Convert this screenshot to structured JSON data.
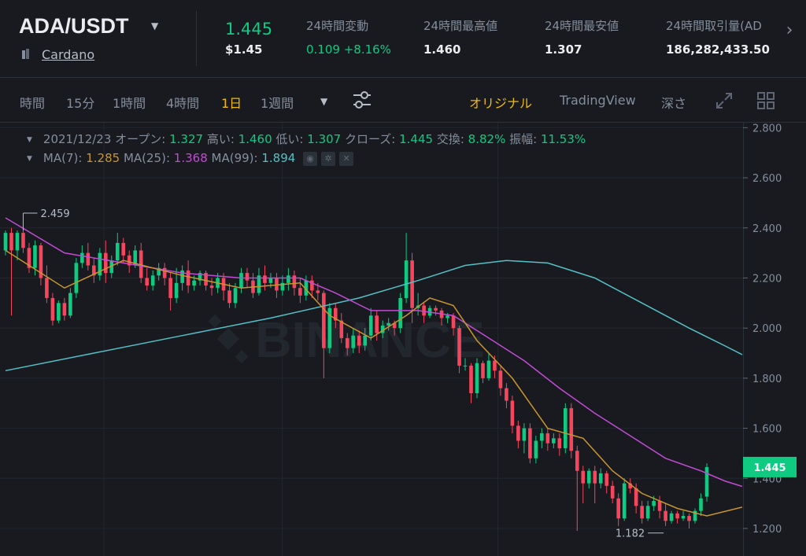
{
  "header": {
    "pair": "ADA/USDT",
    "coin_name": "Cardano",
    "last_price": "1.445",
    "last_price_usd": "$1.45",
    "stats": [
      {
        "label": "24時間変動",
        "value": "0.109 +8.16%",
        "green": true
      },
      {
        "label": "24時間最高値",
        "value": "1.460",
        "green": false
      },
      {
        "label": "24時間最安値",
        "value": "1.307",
        "green": false
      },
      {
        "label": "24時間取引量(AD",
        "value": "186,282,433.50",
        "green": false
      }
    ]
  },
  "toolbar": {
    "intervals": [
      "時間",
      "15分",
      "1時間",
      "4時間",
      "1日",
      "1週間"
    ],
    "active_interval": "1日",
    "views": [
      "オリジナル",
      "TradingView",
      "深さ"
    ],
    "active_view": "オリジナル"
  },
  "ohlc_bar": {
    "date": "2021/12/23",
    "open_label": "オープン:",
    "open": "1.327",
    "high_label": "高い:",
    "high": "1.460",
    "low_label": "低い:",
    "low": "1.307",
    "close_label": "クローズ:",
    "close": "1.445",
    "change_label": "交換:",
    "change": "8.82%",
    "amplitude_label": "振幅:",
    "amplitude": "11.53%"
  },
  "ma_bar": {
    "ma7_label": "MA(7):",
    "ma7": "1.285",
    "ma25_label": "MA(25):",
    "ma25": "1.368",
    "ma99_label": "MA(99):",
    "ma99": "1.894"
  },
  "colors": {
    "up": "#0ecb81",
    "down": "#f6465d",
    "ma7": "#c9952f",
    "ma25": "#c24bd4",
    "ma99": "#54c0c7",
    "accent": "#f0b90b"
  },
  "chart_data": {
    "type": "candlestick",
    "y_ticks": [
      "2.800",
      "2.600",
      "2.400",
      "2.200",
      "2.000",
      "1.800",
      "1.600",
      "1.400",
      "1.200"
    ],
    "ylim": [
      1.09,
      2.82
    ],
    "last_price_label": "1.445",
    "high_marker": "2.459",
    "low_marker": "1.182",
    "watermark": "BINANCE",
    "candles": [
      [
        2.31,
        2.38,
        2.39,
        2.29
      ],
      [
        2.38,
        2.31,
        2.4,
        2.05
      ],
      [
        2.31,
        2.38,
        2.39,
        2.27
      ],
      [
        2.38,
        2.32,
        2.41,
        2.3
      ],
      [
        2.32,
        2.24,
        2.34,
        2.22
      ],
      [
        2.24,
        2.33,
        2.35,
        2.21
      ],
      [
        2.33,
        2.2,
        2.34,
        2.17
      ],
      [
        2.2,
        2.12,
        2.25,
        2.1
      ],
      [
        2.12,
        2.03,
        2.14,
        2.01
      ],
      [
        2.03,
        2.1,
        2.11,
        2.02
      ],
      [
        2.1,
        2.05,
        2.12,
        2.03
      ],
      [
        2.05,
        2.14,
        2.16,
        2.04
      ],
      [
        2.14,
        2.26,
        2.28,
        2.12
      ],
      [
        2.26,
        2.3,
        2.33,
        2.24
      ],
      [
        2.3,
        2.25,
        2.34,
        2.23
      ],
      [
        2.25,
        2.21,
        2.28,
        2.18
      ],
      [
        2.21,
        2.3,
        2.32,
        2.19
      ],
      [
        2.3,
        2.22,
        2.35,
        2.18
      ],
      [
        2.22,
        2.27,
        2.29,
        2.2
      ],
      [
        2.27,
        2.34,
        2.38,
        2.25
      ],
      [
        2.34,
        2.29,
        2.36,
        2.26
      ],
      [
        2.29,
        2.25,
        2.31,
        2.22
      ],
      [
        2.25,
        2.31,
        2.33,
        2.24
      ],
      [
        2.31,
        2.2,
        2.34,
        2.18
      ],
      [
        2.2,
        2.17,
        2.24,
        2.15
      ],
      [
        2.17,
        2.21,
        2.23,
        2.15
      ],
      [
        2.21,
        2.24,
        2.26,
        2.19
      ],
      [
        2.24,
        2.2,
        2.26,
        2.17
      ],
      [
        2.2,
        2.12,
        2.22,
        2.07
      ],
      [
        2.12,
        2.18,
        2.24,
        2.1
      ],
      [
        2.18,
        2.23,
        2.25,
        2.15
      ],
      [
        2.23,
        2.17,
        2.27,
        2.14
      ],
      [
        2.17,
        2.19,
        2.21,
        2.15
      ],
      [
        2.19,
        2.22,
        2.23,
        2.17
      ],
      [
        2.22,
        2.17,
        2.23,
        2.15
      ],
      [
        2.17,
        2.16,
        2.2,
        2.13
      ],
      [
        2.16,
        2.2,
        2.22,
        2.14
      ],
      [
        2.2,
        2.15,
        2.22,
        2.11
      ],
      [
        2.15,
        2.1,
        2.18,
        2.08
      ],
      [
        2.1,
        2.16,
        2.18,
        2.08
      ],
      [
        2.16,
        2.22,
        2.24,
        2.14
      ],
      [
        2.22,
        2.19,
        2.24,
        2.16
      ],
      [
        2.19,
        2.14,
        2.22,
        2.12
      ],
      [
        2.14,
        2.21,
        2.24,
        2.13
      ],
      [
        2.21,
        2.18,
        2.25,
        2.15
      ],
      [
        2.18,
        2.2,
        2.22,
        2.16
      ],
      [
        2.2,
        2.15,
        2.22,
        2.12
      ],
      [
        2.15,
        2.18,
        2.21,
        2.13
      ],
      [
        2.18,
        2.21,
        2.24,
        2.15
      ],
      [
        2.21,
        2.16,
        2.23,
        2.13
      ],
      [
        2.16,
        2.13,
        2.2,
        2.1
      ],
      [
        2.13,
        2.19,
        2.21,
        2.11
      ],
      [
        2.19,
        2.15,
        2.21,
        2.12
      ],
      [
        2.15,
        2.14,
        2.18,
        2.11
      ],
      [
        2.14,
        1.92,
        2.15,
        1.8
      ],
      [
        1.92,
        2.08,
        2.1,
        1.9
      ],
      [
        2.08,
        2.03,
        2.1,
        2.0
      ],
      [
        2.03,
        1.96,
        2.06,
        1.94
      ],
      [
        1.96,
        1.92,
        1.98,
        1.89
      ],
      [
        1.92,
        1.97,
        2.0,
        1.9
      ],
      [
        1.97,
        1.93,
        1.99,
        1.9
      ],
      [
        1.93,
        1.97,
        2.0,
        1.91
      ],
      [
        1.97,
        2.05,
        2.08,
        1.95
      ],
      [
        2.05,
        1.98,
        2.07,
        1.95
      ],
      [
        1.98,
        2.01,
        2.03,
        1.96
      ],
      [
        2.01,
        2.02,
        2.04,
        1.99
      ],
      [
        2.02,
        2.0,
        2.03,
        1.97
      ],
      [
        2.0,
        2.12,
        2.14,
        1.98
      ],
      [
        2.12,
        2.27,
        2.38,
        2.1
      ],
      [
        2.27,
        2.08,
        2.3,
        2.02
      ],
      [
        2.08,
        2.09,
        2.14,
        2.05
      ],
      [
        2.09,
        2.05,
        2.1,
        2.02
      ],
      [
        2.05,
        2.08,
        2.09,
        2.04
      ],
      [
        2.08,
        2.07,
        2.09,
        2.05
      ],
      [
        2.07,
        2.04,
        2.08,
        2.01
      ],
      [
        2.04,
        2.05,
        2.06,
        2.02
      ],
      [
        2.05,
        2.0,
        2.06,
        1.97
      ],
      [
        2.0,
        1.85,
        2.01,
        1.82
      ],
      [
        1.85,
        1.85,
        1.88,
        1.83
      ],
      [
        1.85,
        1.74,
        1.86,
        1.7
      ],
      [
        1.74,
        1.86,
        1.88,
        1.72
      ],
      [
        1.86,
        1.8,
        1.87,
        1.78
      ],
      [
        1.8,
        1.87,
        1.9,
        1.79
      ],
      [
        1.87,
        1.83,
        1.89,
        1.8
      ],
      [
        1.83,
        1.76,
        1.85,
        1.73
      ],
      [
        1.76,
        1.71,
        1.78,
        1.68
      ],
      [
        1.71,
        1.61,
        1.73,
        1.58
      ],
      [
        1.61,
        1.55,
        1.63,
        1.52
      ],
      [
        1.55,
        1.6,
        1.62,
        1.5
      ],
      [
        1.6,
        1.48,
        1.62,
        1.46
      ],
      [
        1.48,
        1.55,
        1.57,
        1.46
      ],
      [
        1.55,
        1.58,
        1.6,
        1.52
      ],
      [
        1.58,
        1.54,
        1.6,
        1.51
      ],
      [
        1.54,
        1.56,
        1.58,
        1.52
      ],
      [
        1.56,
        1.52,
        1.58,
        1.49
      ],
      [
        1.52,
        1.68,
        1.7,
        1.5
      ],
      [
        1.68,
        1.51,
        1.7,
        1.48
      ],
      [
        1.51,
        1.43,
        1.53,
        1.19
      ],
      [
        1.43,
        1.38,
        1.45,
        1.3
      ],
      [
        1.38,
        1.43,
        1.44,
        1.36
      ],
      [
        1.43,
        1.38,
        1.45,
        1.3
      ],
      [
        1.38,
        1.42,
        1.44,
        1.36
      ],
      [
        1.42,
        1.37,
        1.43,
        1.34
      ],
      [
        1.37,
        1.32,
        1.39,
        1.3
      ],
      [
        1.32,
        1.24,
        1.34,
        1.21
      ],
      [
        1.24,
        1.38,
        1.4,
        1.23
      ],
      [
        1.38,
        1.36,
        1.4,
        1.34
      ],
      [
        1.36,
        1.29,
        1.38,
        1.26
      ],
      [
        1.29,
        1.24,
        1.31,
        1.22
      ],
      [
        1.24,
        1.29,
        1.31,
        1.23
      ],
      [
        1.29,
        1.31,
        1.33,
        1.27
      ],
      [
        1.31,
        1.27,
        1.33,
        1.24
      ],
      [
        1.27,
        1.23,
        1.3,
        1.21
      ],
      [
        1.23,
        1.26,
        1.27,
        1.22
      ],
      [
        1.26,
        1.24,
        1.27,
        1.22
      ],
      [
        1.24,
        1.25,
        1.27,
        1.23
      ],
      [
        1.25,
        1.23,
        1.26,
        1.2
      ],
      [
        1.23,
        1.27,
        1.28,
        1.22
      ],
      [
        1.27,
        1.32,
        1.34,
        1.25
      ],
      [
        1.327,
        1.445,
        1.46,
        1.307
      ]
    ],
    "ma7": [
      [
        0,
        2.31
      ],
      [
        10,
        2.16
      ],
      [
        20,
        2.27
      ],
      [
        30,
        2.21
      ],
      [
        40,
        2.16
      ],
      [
        50,
        2.18
      ],
      [
        55,
        2.05
      ],
      [
        62,
        1.96
      ],
      [
        68,
        2.05
      ],
      [
        72,
        2.12
      ],
      [
        76,
        2.09
      ],
      [
        80,
        1.95
      ],
      [
        86,
        1.8
      ],
      [
        92,
        1.6
      ],
      [
        98,
        1.56
      ],
      [
        103,
        1.43
      ],
      [
        108,
        1.34
      ],
      [
        114,
        1.28
      ],
      [
        119,
        1.25
      ],
      [
        125,
        1.285
      ]
    ],
    "ma25": [
      [
        0,
        2.44
      ],
      [
        10,
        2.3
      ],
      [
        20,
        2.26
      ],
      [
        30,
        2.22
      ],
      [
        40,
        2.2
      ],
      [
        50,
        2.2
      ],
      [
        56,
        2.14
      ],
      [
        62,
        2.07
      ],
      [
        70,
        2.07
      ],
      [
        76,
        2.05
      ],
      [
        82,
        1.96
      ],
      [
        88,
        1.87
      ],
      [
        94,
        1.76
      ],
      [
        100,
        1.66
      ],
      [
        106,
        1.57
      ],
      [
        112,
        1.48
      ],
      [
        118,
        1.43
      ],
      [
        122,
        1.39
      ],
      [
        125,
        1.368
      ]
    ],
    "ma99": [
      [
        0,
        1.83
      ],
      [
        15,
        1.9
      ],
      [
        30,
        1.97
      ],
      [
        45,
        2.04
      ],
      [
        60,
        2.12
      ],
      [
        70,
        2.19
      ],
      [
        78,
        2.25
      ],
      [
        85,
        2.27
      ],
      [
        92,
        2.26
      ],
      [
        100,
        2.2
      ],
      [
        108,
        2.1
      ],
      [
        116,
        2.0
      ],
      [
        122,
        1.93
      ],
      [
        125,
        1.894
      ]
    ]
  }
}
